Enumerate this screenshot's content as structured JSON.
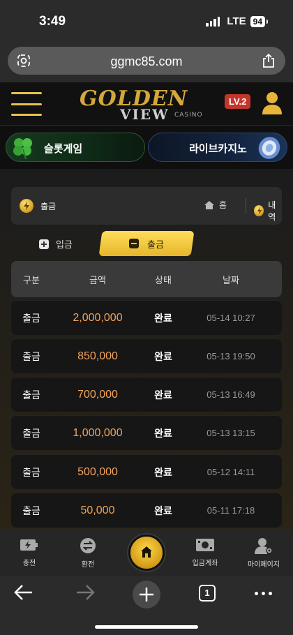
{
  "status_bar": {
    "time": "3:49",
    "network": "LTE",
    "battery": "94"
  },
  "browser": {
    "url": "ggmc85.com",
    "tab_count": "1"
  },
  "site": {
    "logo_golden": "GOLDEN",
    "logo_view": "VIEW",
    "logo_casino": "CASINO",
    "level_badge": "LV.2"
  },
  "banners": {
    "slot_label": "슬롯게임",
    "live_label": "라이브카지노"
  },
  "breadcrumb": {
    "title": "출금",
    "home_label": "홈",
    "history_label": "내역"
  },
  "tabs": {
    "deposit_label": "입금",
    "withdraw_label": "출금"
  },
  "table": {
    "headers": [
      "구분",
      "금액",
      "상태",
      "날짜"
    ],
    "rows": [
      {
        "type": "출금",
        "amount": "2,000,000",
        "status": "완료",
        "date": "05-14 10:27"
      },
      {
        "type": "출금",
        "amount": "850,000",
        "status": "완료",
        "date": "05-13 19:50"
      },
      {
        "type": "출금",
        "amount": "700,000",
        "status": "완료",
        "date": "05-13 16:49"
      },
      {
        "type": "출금",
        "amount": "1,000,000",
        "status": "완료",
        "date": "05-13 13:15"
      },
      {
        "type": "출금",
        "amount": "500,000",
        "status": "완료",
        "date": "05-12 14:11"
      },
      {
        "type": "출금",
        "amount": "50,000",
        "status": "완료",
        "date": "05-11 17:18"
      }
    ]
  },
  "bottom_nav": {
    "charge_label": "충전",
    "exchange_label": "환전",
    "deposit_account_label": "입금계좌",
    "mypage_label": "마이페이지"
  },
  "colors": {
    "accent_gold": "#e8c34a",
    "amount_orange": "#f3a35a",
    "level_red": "#c3362b"
  }
}
